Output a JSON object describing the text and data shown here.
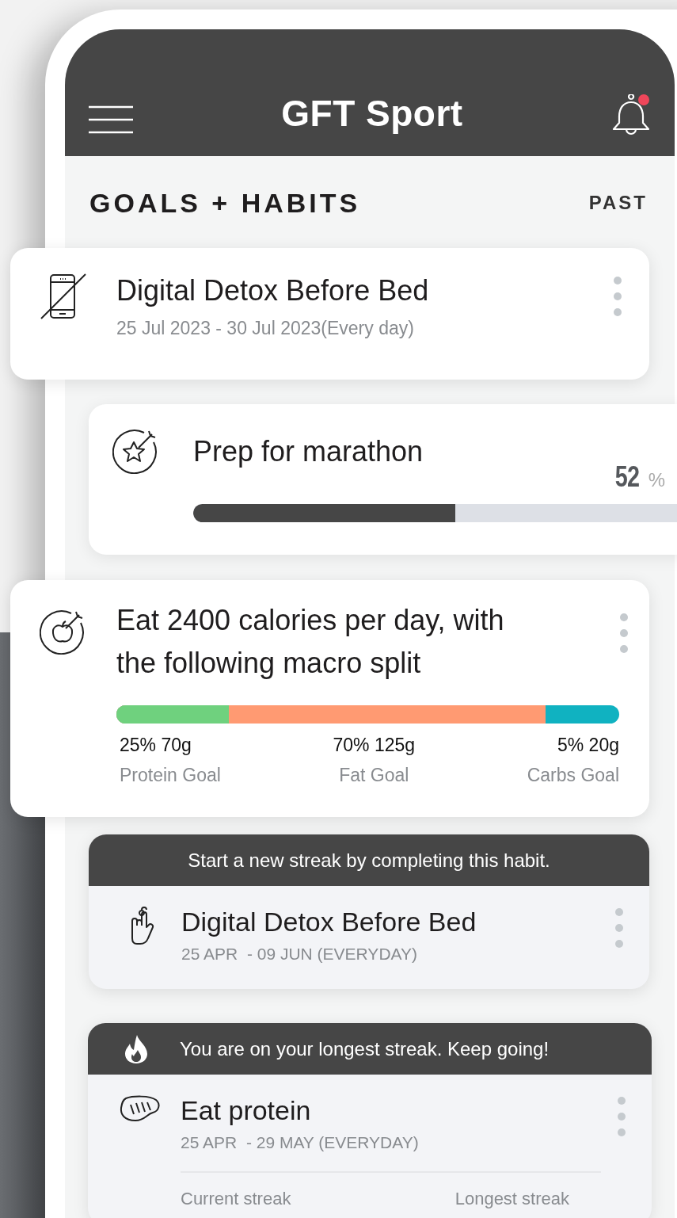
{
  "app_bar": {
    "title": "GFT Sport",
    "notification_dot": true
  },
  "section": {
    "title": "GOALS + HABITS",
    "link": "PAST"
  },
  "cards": [
    {
      "kind": "habit",
      "title": "Digital Detox Before Bed",
      "subtitle": "25 Jul 2023 - 30 Jul 2023(Every day)"
    },
    {
      "kind": "progress",
      "title": "Prep for marathon",
      "level": 0.52,
      "value": "52",
      "unit": "%"
    },
    {
      "kind": "macro",
      "title": "Eat 2400 calories per day, with the following macro split",
      "segments": [
        {
          "value": "25% 70g",
          "label": "Protein Goal",
          "level": 0.224,
          "color": "#6fd17e"
        },
        {
          "value": "70% 125g",
          "label": "Fat Goal",
          "level": 0.854,
          "color": "#ff9a72"
        },
        {
          "value": "5% 20g",
          "label": "Carbs Goal",
          "color": "#10b2c1"
        }
      ]
    },
    {
      "kind": "streak",
      "banner": {
        "text": "Start a new streak by completing this habit.",
        "flame": false
      },
      "title": "Digital Detox Before Bed",
      "subtitle": "25 APR  - 09 JUN (EVERYDAY)"
    },
    {
      "kind": "streak",
      "banner": {
        "text": "You are on your longest streak. Keep going!",
        "flame": true
      },
      "title": "Eat protein",
      "subtitle": "25 APR  - 29 MAY (EVERYDAY)",
      "stats": [
        "Current streak",
        "Longest streak"
      ]
    }
  ]
}
